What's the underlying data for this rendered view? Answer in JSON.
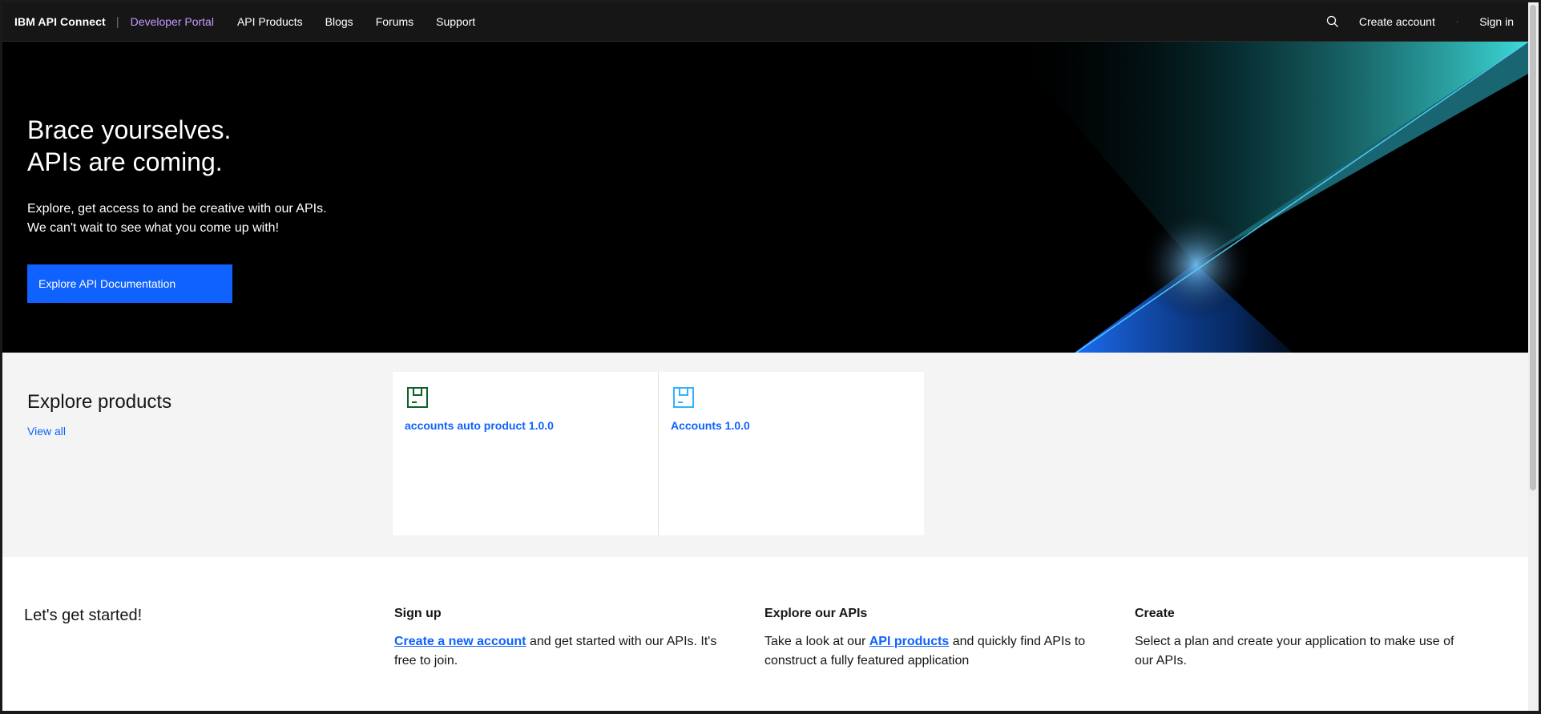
{
  "nav": {
    "brand": "IBM API Connect",
    "separator": "|",
    "portal": "Developer Portal",
    "links": [
      "API Products",
      "Blogs",
      "Forums",
      "Support"
    ],
    "search_icon": "search-icon",
    "create_account": "Create account",
    "dot": "·",
    "sign_in": "Sign in"
  },
  "hero": {
    "title_line1": "Brace yourselves.",
    "title_line2": "APIs are coming.",
    "subtitle_line1": "Explore, get access to and be creative with our APIs.",
    "subtitle_line2": "We can't wait to see what you come up with!",
    "cta_label": "Explore API Documentation"
  },
  "products": {
    "heading": "Explore products",
    "view_all": "View all",
    "cards": [
      {
        "title": "accounts auto product 1.0.0",
        "icon": "product-box-icon",
        "icon_color": "#0e6027"
      },
      {
        "title": "Accounts 1.0.0",
        "icon": "product-box-icon",
        "icon_color": "#33b1ff"
      }
    ]
  },
  "started": {
    "heading": "Let's get started!",
    "signup": {
      "title": "Sign up",
      "link": "Create a new account",
      "text": " and get started with our APIs. It's free to join."
    },
    "explore": {
      "title": "Explore our APIs",
      "text_before": "Take a look at our ",
      "link": "API products",
      "text_after": " and quickly find APIs to construct a fully featured application"
    },
    "create": {
      "title": "Create",
      "text": "Select a plan and create your application to make use of our APIs."
    }
  },
  "colors": {
    "nav_bg": "#161616",
    "hero_bg": "#000000",
    "primary_blue": "#0f62fe",
    "portal_purple": "#c69bff",
    "teal_accent": "#3ddbd9"
  }
}
